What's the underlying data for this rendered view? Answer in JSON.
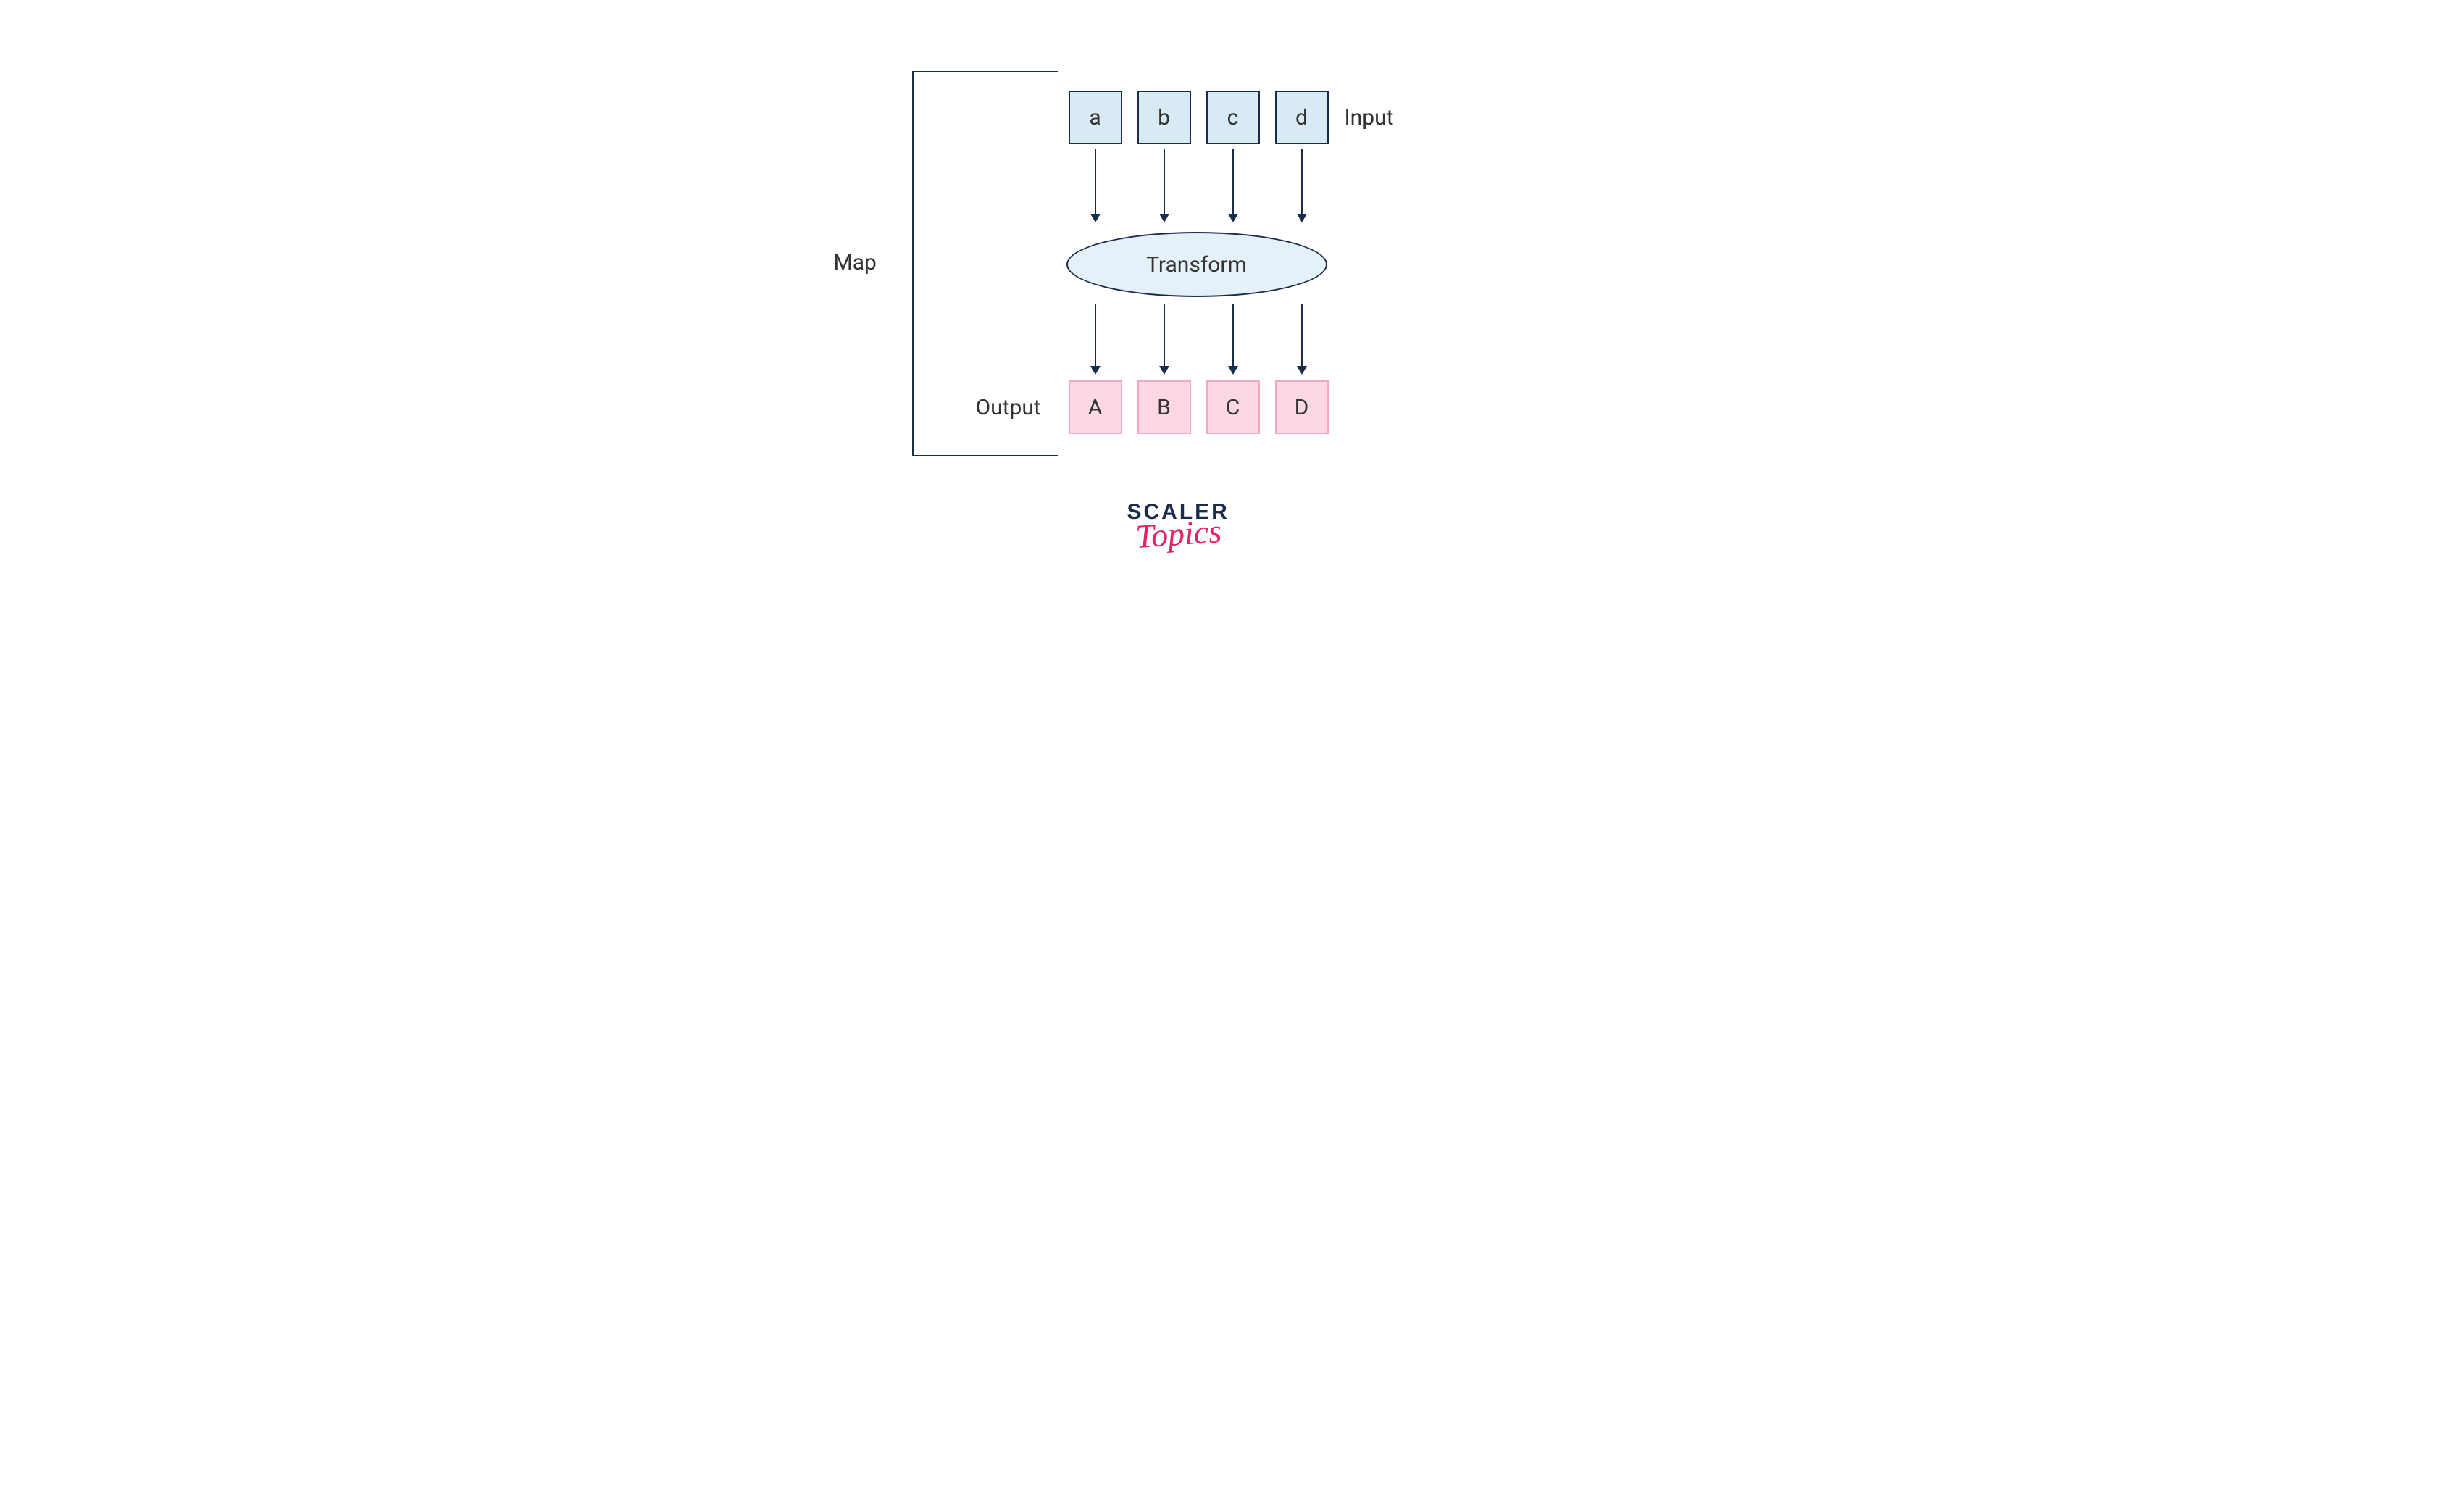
{
  "labels": {
    "map": "Map",
    "input": "Input",
    "output": "Output",
    "transform": "Transform"
  },
  "input_values": [
    "a",
    "b",
    "c",
    "d"
  ],
  "output_values": [
    "A",
    "B",
    "C",
    "D"
  ],
  "branding": {
    "line1": "SCALER",
    "line2": "Topics"
  },
  "colors": {
    "stroke_dark": "#1a2c4e",
    "input_fill": "#d8eaf4",
    "output_fill": "#fbd8e4",
    "output_border": "#f3a8c2",
    "accent_pink": "#e91e63"
  }
}
